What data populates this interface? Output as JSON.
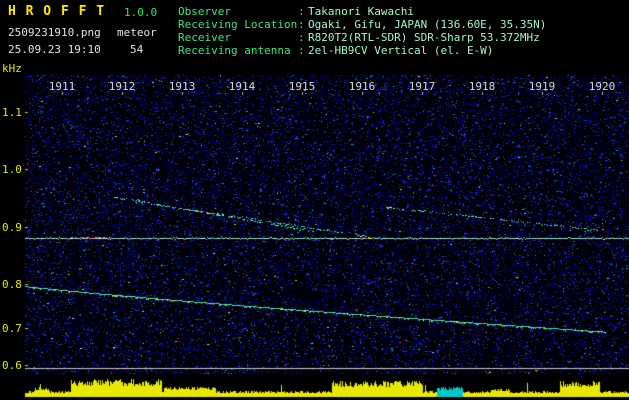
{
  "app": {
    "title": "H R O F F T",
    "version": "1.0.0",
    "filename": "2509231910.png",
    "mode": "meteor",
    "datetime": "25.09.23 19:10",
    "count": "54"
  },
  "observer_info": {
    "separator": ":",
    "rows": [
      {
        "label": "Observer",
        "value": "Takanori Kawachi"
      },
      {
        "label": "Receiving Location",
        "value": "Ogaki, Gifu, JAPAN (136.60E, 35.35N)"
      },
      {
        "label": "Receiver",
        "value": "R820T2(RTL-SDR) SDR-Sharp 53.372MHz"
      },
      {
        "label": "Receiving antenna",
        "value": "2el-HB9CV Vertical (el. E-W)"
      }
    ]
  },
  "chart_data": {
    "type": "heatmap",
    "subtype": "meteor-radio-spectrogram",
    "title": "HROFFT 10-minute spectrogram 19:10-19:20",
    "ylabel": "kHz",
    "x_ticks": [
      "1911",
      "1912",
      "1913",
      "1914",
      "1915",
      "1916",
      "1917",
      "1918",
      "1919",
      "1920"
    ],
    "y_ticks": [
      "1.1",
      "1.0",
      "0.9",
      "0.8",
      "0.7",
      "0.6"
    ],
    "x_range_minutes": [
      1910,
      1920
    ],
    "y_range_khz": [
      0.55,
      1.17
    ],
    "colors": {
      "background": "#000006",
      "noise_blues": [
        "#000066",
        "#0000a0",
        "#1b2ac0",
        "#2f46d8",
        "#0a1470"
      ],
      "noise_sparkles": [
        "#0080a0",
        "#00b8c8",
        "#58e0e8",
        "#c04878",
        "#c8c838",
        "#d0d0e0",
        "#8858c8"
      ],
      "axis_label": "#e8e800",
      "time_label": "#d8d8d8"
    },
    "carrier": {
      "freq_khz": 0.88,
      "time": [
        1910.0,
        1920.05
      ],
      "color": "#9adcc2",
      "hotspots": [
        {
          "t": [
            1911.15,
            1911.9
          ],
          "color": "#ff8098"
        },
        {
          "t": [
            1916.02,
            1916.14
          ],
          "color": "#ff4040"
        }
      ]
    },
    "traces": [
      {
        "name": "drift-trace-1",
        "style": "dotted",
        "color": "#55e8b8",
        "from": {
          "t": 1911.85,
          "f": 0.952
        },
        "to": {
          "t": 1915.3,
          "f": 0.89
        }
      },
      {
        "name": "drift-trace-2",
        "style": "dotted",
        "color": "#44d8ae",
        "from": {
          "t": 1912.2,
          "f": 0.944
        },
        "to": {
          "t": 1916.1,
          "f": 0.883
        }
      },
      {
        "name": "drift-trace-3",
        "style": "dotted",
        "color": "#55e8b8",
        "from": {
          "t": 1916.4,
          "f": 0.934
        },
        "to": {
          "t": 1920.05,
          "f": 0.893
        }
      },
      {
        "name": "doppler-trace",
        "style": "solid",
        "curve": 0.85,
        "color": "#3fd9a4",
        "from": {
          "t": 1910.05,
          "f": 0.801
        },
        "to": {
          "t": 1920.05,
          "f": 0.69
        }
      }
    ],
    "baseline": {
      "freq_khz": 0.592,
      "color": "#c8c8c8"
    },
    "amplitude_strip": {
      "bar_color": "#e8e800",
      "base_level": 0.18,
      "highlight": {
        "t": [
          1917.25,
          1917.67
        ],
        "color": "#00c8c8",
        "level": 0.5
      },
      "bursts": [
        {
          "t": [
            1910.55,
            1910.78
          ],
          "level": 0.45
        },
        {
          "t": [
            1911.15,
            1912.65
          ],
          "level": 0.95
        },
        {
          "t": [
            1912.7,
            1913.55
          ],
          "level": 0.5
        },
        {
          "t": [
            1915.5,
            1917.0
          ],
          "level": 0.85
        },
        {
          "t": [
            1918.15,
            1918.45
          ],
          "level": 0.4
        },
        {
          "t": [
            1919.3,
            1919.95
          ],
          "level": 0.82
        }
      ]
    }
  }
}
